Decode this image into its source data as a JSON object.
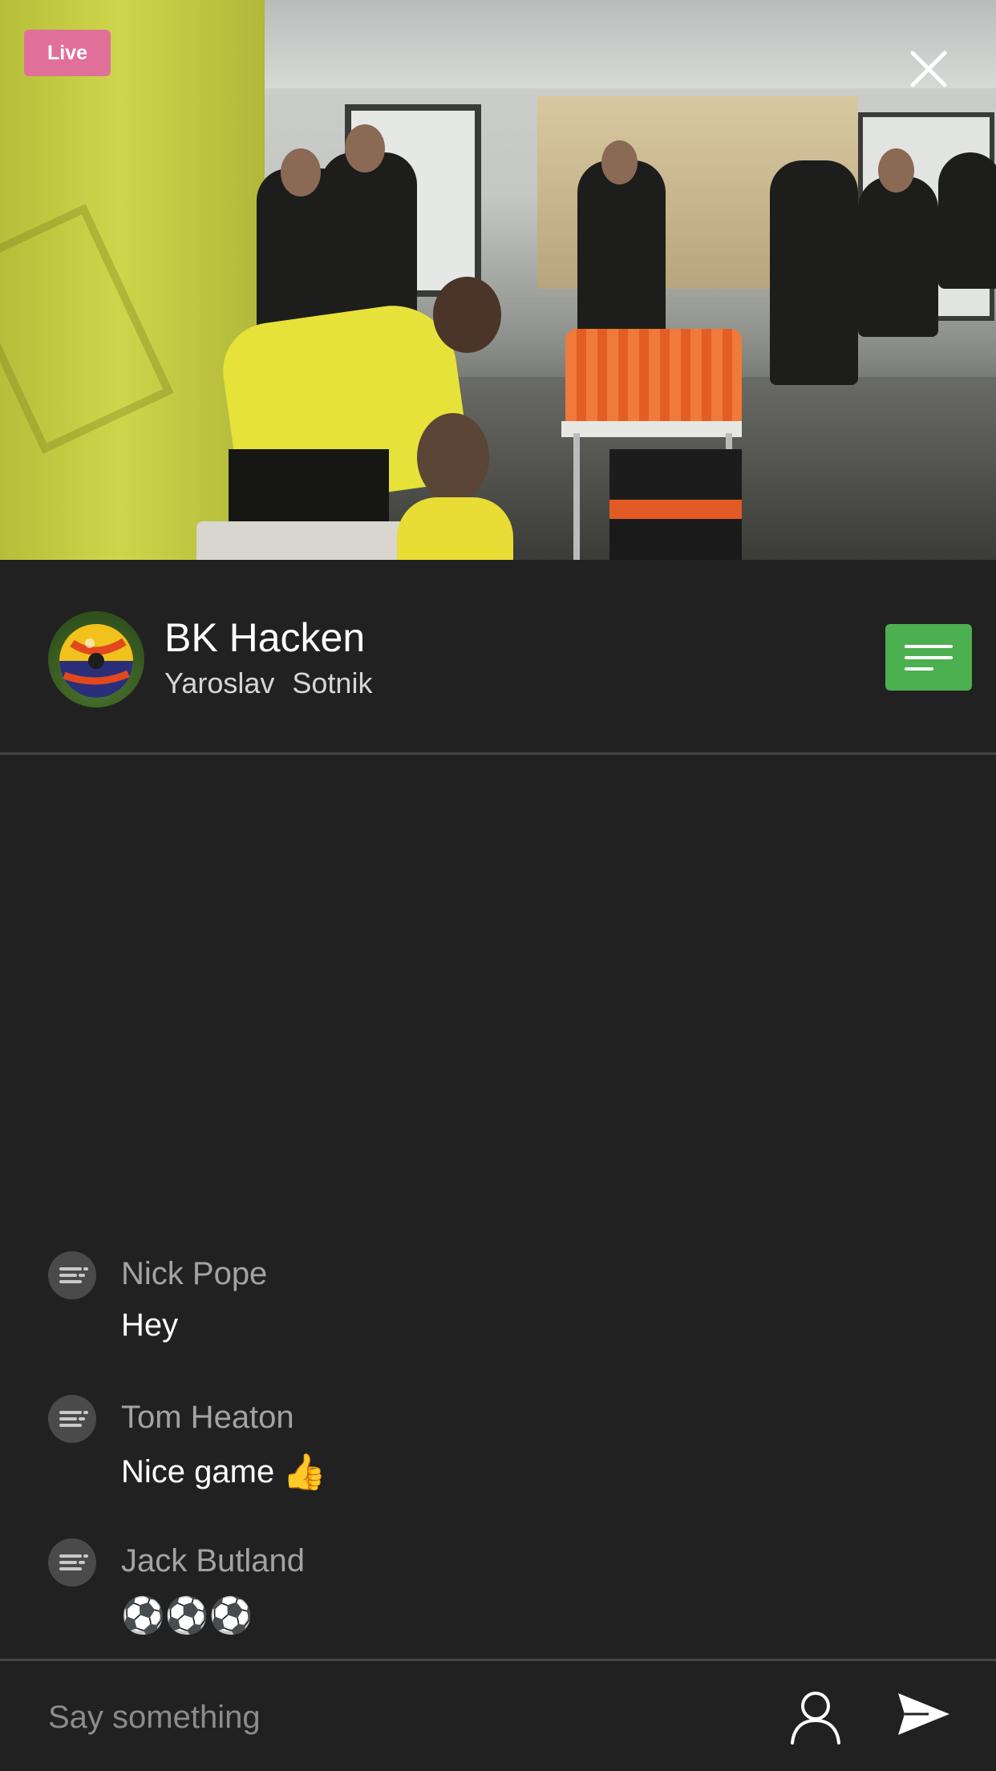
{
  "video": {
    "live_label": "Live",
    "close_icon": "close-icon"
  },
  "header": {
    "channel_title": "BK Hacken",
    "subtitle_first": "Yaroslav",
    "subtitle_last": "Sotnik",
    "menu_icon": "menu-lines-icon",
    "menu_color": "#4caf50"
  },
  "chat": {
    "messages": [
      {
        "author": "Nick Pope",
        "text": "Hey",
        "emoji": ""
      },
      {
        "author": "Tom Heaton",
        "text": "Nice game",
        "emoji": "👍"
      },
      {
        "author": "Jack Butland",
        "text": "⚽⚽⚽",
        "emoji": ""
      }
    ]
  },
  "composer": {
    "placeholder": "Say something",
    "user_icon": "user-icon",
    "send_icon": "send-icon"
  },
  "colors": {
    "background": "#212121",
    "live_badge": "#e0709a",
    "accent_green": "#4caf50"
  }
}
